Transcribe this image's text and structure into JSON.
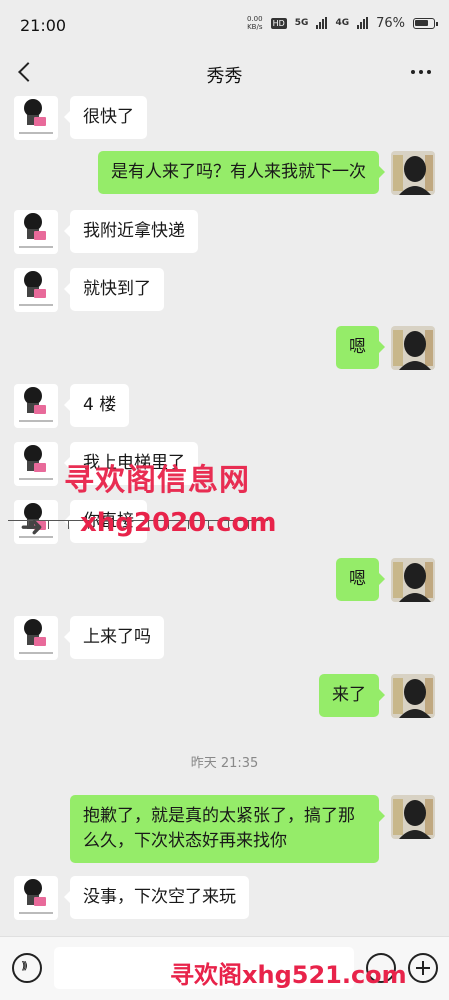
{
  "status": {
    "time": "21:00",
    "speed_value": "0.00",
    "speed_unit": "KB/s",
    "hd": "HD",
    "net1": "5G",
    "net2": "4G",
    "battery": "76%"
  },
  "header": {
    "title": "秀秀"
  },
  "messages": [
    {
      "side": "left",
      "text": "很快了"
    },
    {
      "side": "right",
      "text": "是有人来了吗？有人来我就下一次"
    },
    {
      "side": "left",
      "text": "我附近拿快递"
    },
    {
      "side": "left",
      "text": "就快到了"
    },
    {
      "side": "right",
      "text": "嗯"
    },
    {
      "side": "left",
      "text": "4 楼"
    },
    {
      "side": "left",
      "text": "我上电梯里了"
    },
    {
      "side": "left",
      "text": "你直接"
    },
    {
      "side": "right",
      "text": "嗯"
    },
    {
      "side": "left",
      "text": "上来了吗"
    },
    {
      "side": "right",
      "text": "来了"
    },
    {
      "side": "right",
      "text": "抱歉了，就是真的太紧张了，搞了那么久，下次状态好再来找你"
    },
    {
      "side": "left",
      "text": "没事，下次空了来玩"
    }
  ],
  "timestamp": "昨天 21:35",
  "avatar_left_caption": "美濠姐太不接单了",
  "watermarks": {
    "site_cn": "寻欢阁信息网",
    "site_url": "xhg2020.com",
    "bottom": "寻欢阁xhg521.com"
  },
  "colors": {
    "bubble_right": "#95ec69",
    "bubble_left": "#ffffff",
    "background": "#ededed",
    "watermark": "#e8234a"
  }
}
